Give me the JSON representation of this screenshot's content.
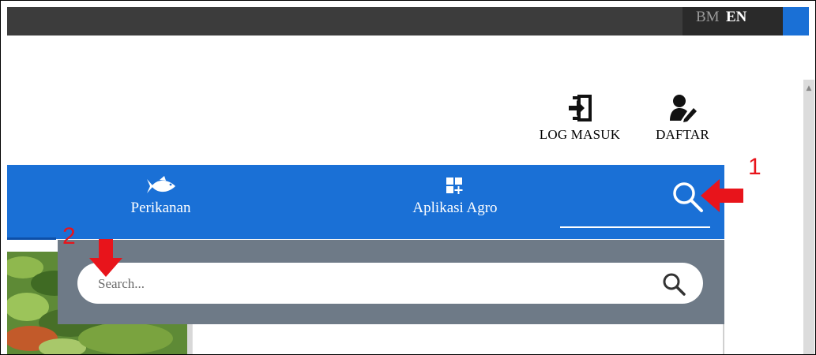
{
  "topbar": {
    "lang_bm": "BM",
    "lang_en": "EN"
  },
  "account": {
    "login_label": "LOG MASUK",
    "login_icon": "sign-in-icon",
    "register_label": "DAFTAR",
    "register_icon": "user-edit-icon"
  },
  "nav": {
    "items": [
      {
        "label": "Perikanan",
        "icon": "fish-icon"
      },
      {
        "label": "Aplikasi Agro",
        "icon": "apps-add-icon"
      }
    ],
    "search_icon": "search-icon"
  },
  "search": {
    "placeholder": "Search...",
    "value": ""
  },
  "annotations": {
    "one": "1",
    "two": "2",
    "color": "#e8141b"
  },
  "colors": {
    "nav_blue": "#1a70d6",
    "panel_grey": "#6e7a87",
    "topbar_dark": "#3c3c3c"
  }
}
